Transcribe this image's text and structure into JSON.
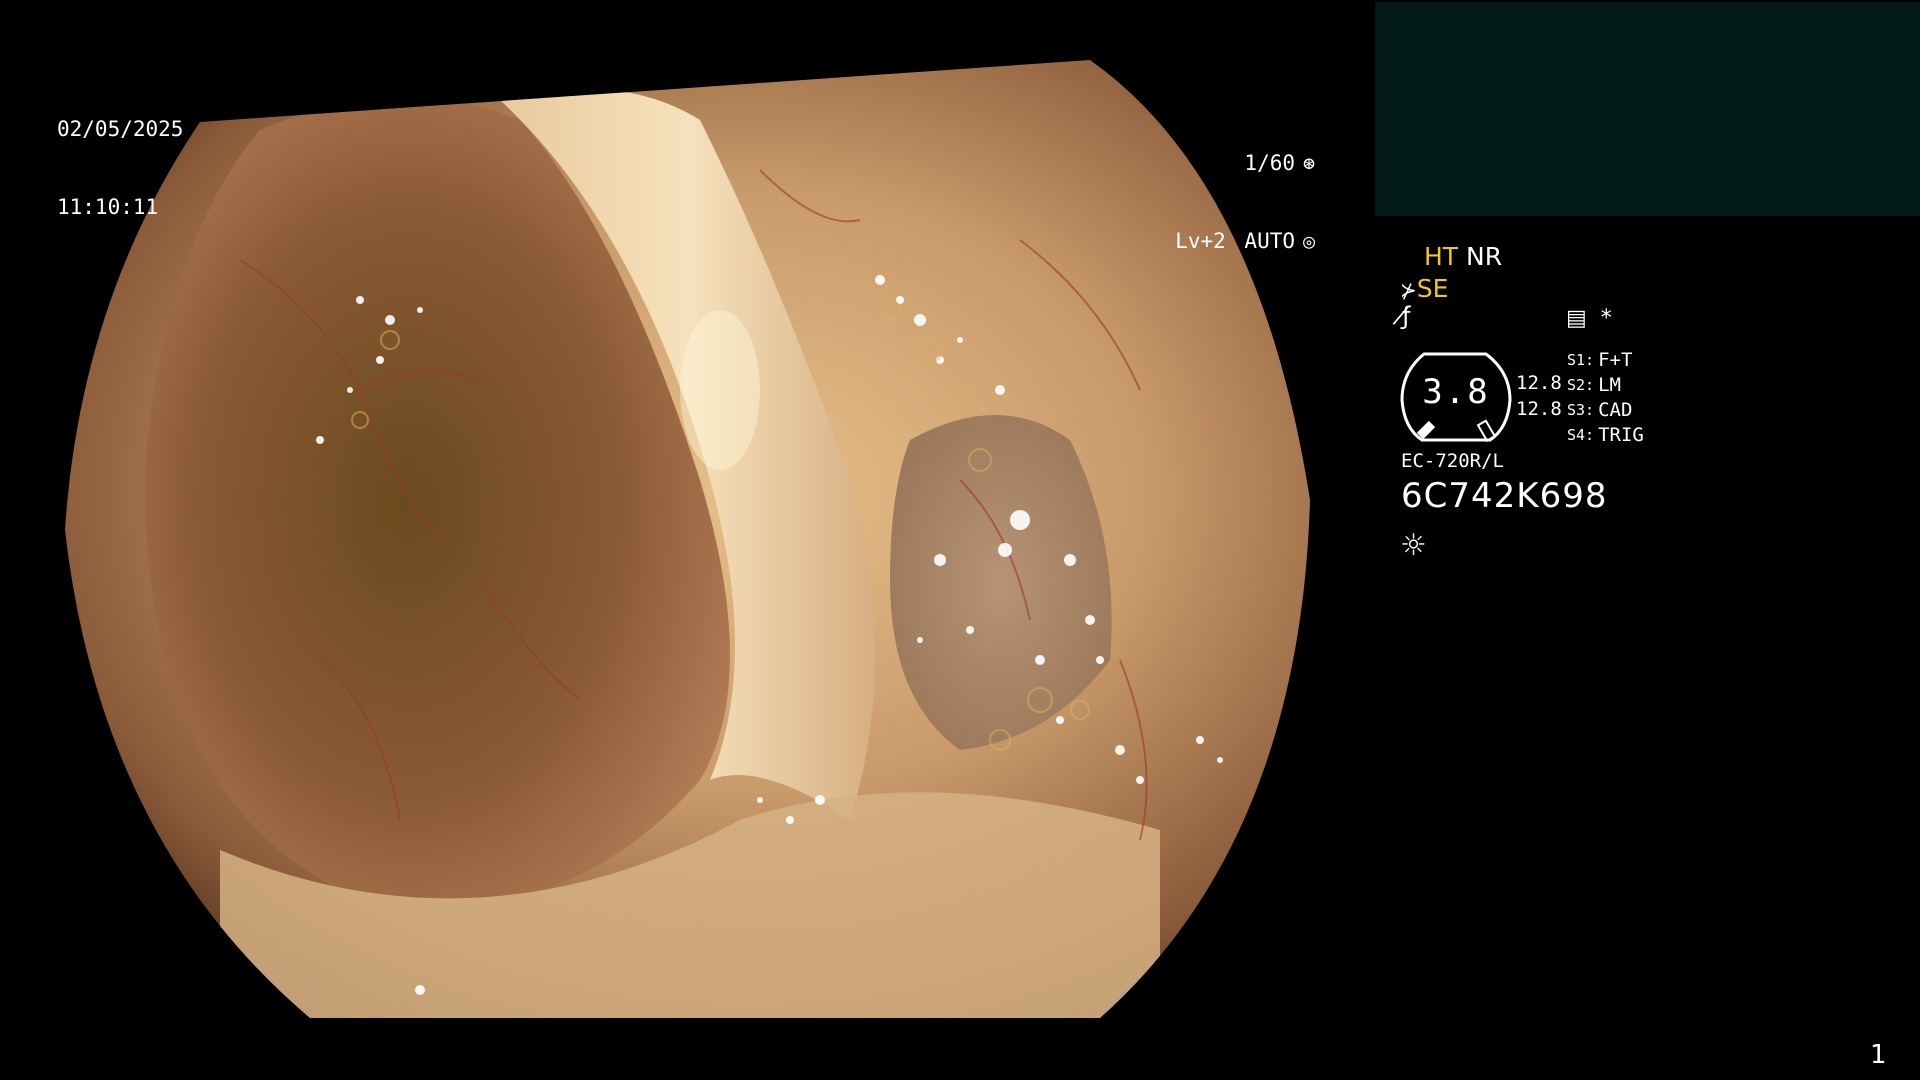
{
  "overlay": {
    "date": "02/05/2025",
    "time": "11:10:11",
    "shutter": "1/60",
    "shutter_icon": "aperture-icon",
    "level": "Lv+2",
    "iris": "AUTO",
    "iris_icon": "target-icon"
  },
  "panel": {
    "ht": "HT",
    "nr": "NR",
    "se": "SE",
    "se_icon": "freeze-icon",
    "hf_icon": "f-hook-icon",
    "storage_icon": "film-icon",
    "asterisk": "*",
    "dial_value": "3.8",
    "dial_readout_1": "12.8",
    "dial_readout_2": "12.8",
    "switches": [
      {
        "key": "S1:",
        "value": "F+T"
      },
      {
        "key": "S2:",
        "value": "LM"
      },
      {
        "key": "S3:",
        "value": "CAD"
      },
      {
        "key": "S4:",
        "value": "TRIG"
      }
    ],
    "scope_model": "EC-720R/L",
    "scope_serial": "6C742K698",
    "light_icon": "sun-icon"
  },
  "page_number": "1",
  "colors": {
    "background": "#000000",
    "thumbnail_box": "#011a17",
    "highlight": "#f2c230",
    "text": "#ffffff"
  }
}
